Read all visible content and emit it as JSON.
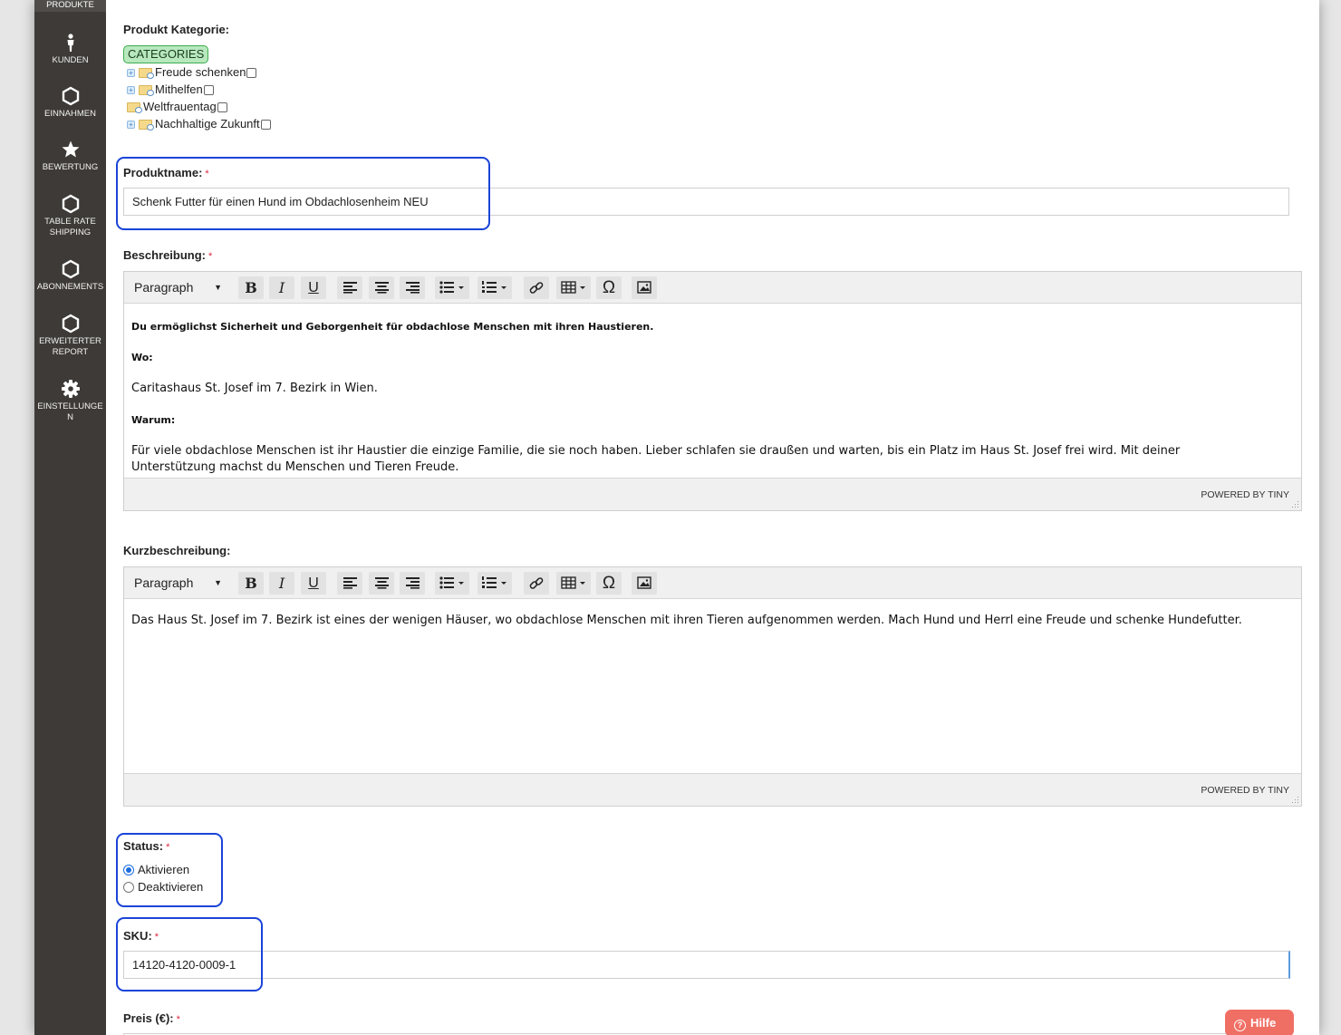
{
  "sidebar": {
    "top_item": "PRODUKTE",
    "items": [
      {
        "icon": "person-icon",
        "label": "KUNDEN"
      },
      {
        "icon": "hexagon-icon",
        "label": "EINNAHMEN"
      },
      {
        "icon": "star-icon",
        "label": "BEWERTUNG"
      },
      {
        "icon": "hexagon-icon",
        "label_line1": "TABLE RATE",
        "label_line2": "SHIPPING"
      },
      {
        "icon": "hexagon-icon",
        "label": "ABONNEMENTS"
      },
      {
        "icon": "hexagon-icon",
        "label_line1": "ERWEITERTER",
        "label_line2": "REPORT"
      },
      {
        "icon": "gear-icon",
        "label_line1": "EINSTELLUNGE",
        "label_line2": "N"
      }
    ]
  },
  "form": {
    "category": {
      "label": "Produkt Kategorie:",
      "root": "CATEGORIES",
      "items": [
        "Freude schenken",
        "Mithelfen",
        "Weltfrauentag",
        "Nachhaltige Zukunft"
      ]
    },
    "name": {
      "label": "Produktname:",
      "required": "*",
      "value": "Schenk Futter für einen Hund im Obdachlosenheim NEU"
    },
    "description": {
      "label": "Beschreibung:",
      "required": "*",
      "content": {
        "p1": "Du ermöglichst Sicherheit und Geborgenheit für obdachlose Menschen mit ihren Haustieren.",
        "h_where": "Wo:",
        "p_where": "Caritashaus St. Josef im 7. Bezirk in Wien.",
        "h_why": "Warum:",
        "p_why_1": "Für viele obdachlose Menschen ist ihr Haustier die einzige Familie, die sie noch haben. Lieber schlafen sie draußen und warten, bis ein Platz im Haus St. Josef frei wird. Mit deiner",
        "p_why_2": "Unterstützung machst du Menschen und Tieren Freude."
      }
    },
    "short_description": {
      "label": "Kurzbeschreibung:",
      "content": "Das Haus St. Josef im 7. Bezirk ist eines der wenigen Häuser, wo obdachlose Menschen mit ihren Tieren aufgenommen werden. Mach Hund und Herrl eine Freude und schenke Hundefutter."
    },
    "editor": {
      "format_select": "Paragraph",
      "bold": "B",
      "italic": "I",
      "underline": "U",
      "special_char": "Ω",
      "powered_by": "POWERED BY TINY"
    },
    "status": {
      "label": "Status:",
      "required": "*",
      "options": [
        "Aktivieren",
        "Deaktivieren"
      ],
      "selected": "Aktivieren"
    },
    "sku": {
      "label": "SKU:",
      "required": "*",
      "value": "14120-4120-0009-1"
    },
    "price": {
      "label": "Preis (€):",
      "required": "*"
    }
  },
  "help_button": "Hilfe",
  "colors": {
    "sidebar_bg": "#3d3a37",
    "highlight_border": "#1a44d8",
    "required": "#d9263c",
    "help_bg": "#f06f65",
    "category_badge_bg": "#b8e8bd"
  }
}
